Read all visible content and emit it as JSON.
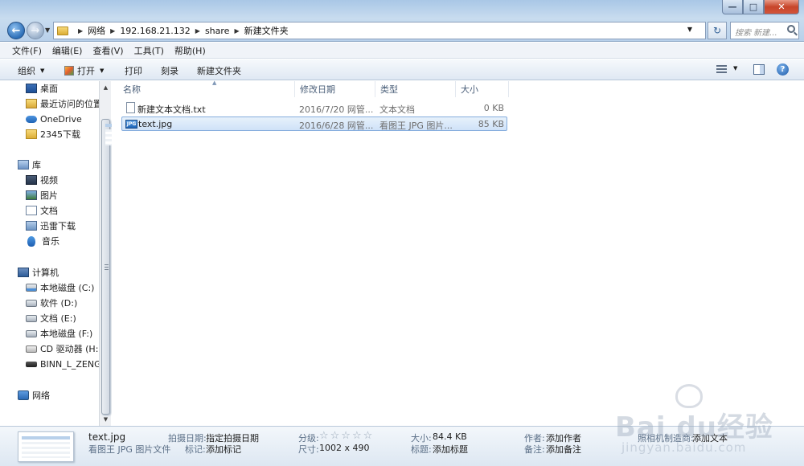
{
  "window": {
    "minimize_glyph": "—",
    "maximize_glyph": "□",
    "close_glyph": "✕"
  },
  "address": {
    "crumbs": [
      "网络",
      "192.168.21.132",
      "share",
      "新建文件夹"
    ],
    "search_placeholder": "搜索 新建..."
  },
  "menu": {
    "items": [
      "文件(F)",
      "编辑(E)",
      "查看(V)",
      "工具(T)",
      "帮助(H)"
    ]
  },
  "toolbar": {
    "organize": "组织",
    "open": "打开",
    "print": "打印",
    "burn": "刻录",
    "new_folder": "新建文件夹"
  },
  "sidebar": {
    "favorites": [
      "桌面",
      "最近访问的位置",
      "OneDrive",
      "2345下载"
    ],
    "libraries_header": "库",
    "libraries": [
      "视频",
      "图片",
      "文档",
      "迅雷下载",
      "音乐"
    ],
    "computer_header": "计算机",
    "drives": [
      "本地磁盘 (C:)",
      "软件 (D:)",
      "文档 (E:)",
      "本地磁盘 (F:)",
      "CD 驱动器 (H:)",
      "BINN_L_ZENG ("
    ],
    "network": "网络"
  },
  "columns": [
    "名称",
    "修改日期",
    "类型",
    "大小"
  ],
  "files": [
    {
      "name": "新建文本文档.txt",
      "date": "2016/7/20 网管...",
      "type": "文本文档",
      "size": "0 KB"
    },
    {
      "name": "text.jpg",
      "date": "2016/6/28 网管...",
      "type": "看图王 JPG 图片...",
      "size": "85 KB"
    }
  ],
  "details": {
    "filename": "text.jpg",
    "filetype": "看图王 JPG 图片文件",
    "date_taken_label": "拍摄日期:",
    "date_taken_value": "指定拍摄日期",
    "tags_label": "标记:",
    "tags_value": "添加标记",
    "rating_label": "分级:",
    "rating_stars": "☆☆☆☆☆",
    "dimensions_label": "尺寸:",
    "dimensions_value": "1002 x 490",
    "size_label": "大小:",
    "size_value": "84.4 KB",
    "title_label": "标题:",
    "title_value": "添加标题",
    "author_label": "作者:",
    "author_value": "添加作者",
    "comments_label": "备注:",
    "comments_value": "添加备注",
    "camera_label": "照相机制造商:",
    "camera_value": "添加文本"
  },
  "watermark": {
    "brand": "Bai du经验",
    "url": "jingyan.baidu.com"
  }
}
